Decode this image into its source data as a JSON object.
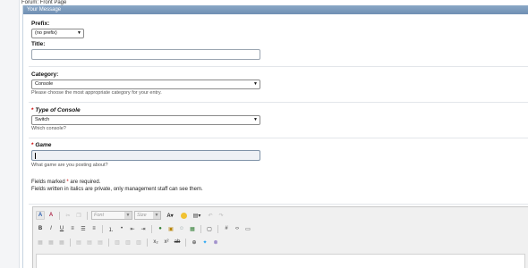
{
  "breadcrumb": "Forum: Front Page",
  "panel": {
    "title": "Your Message"
  },
  "prefix": {
    "label": "Prefix:",
    "value": "(no prefix)"
  },
  "title": {
    "label": "Title:",
    "value": ""
  },
  "category": {
    "label": "Category:",
    "value": "Console",
    "hint": "Please choose the most appropriate category for your entry."
  },
  "console_type": {
    "star": "*",
    "label": "Type of Console",
    "value": "Switch",
    "hint": "Which console?"
  },
  "game": {
    "star": "*",
    "label": "Game",
    "value": "",
    "hint": "What game are you posting about?"
  },
  "notes": {
    "line1_prefix": "Fields marked",
    "star": "*",
    "line1_suffix": "are required.",
    "line2": "Fields written in italics are private, only management staff can see them."
  },
  "editor": {
    "font_placeholder": "Font",
    "size_placeholder": "Size",
    "row1_icons": [
      "switch-mode-icon",
      "remove-format-icon",
      "cut-icon",
      "copy-icon",
      "font-select",
      "size-select",
      "text-color-icon",
      "highlight-icon",
      "paste-icon",
      "undo-icon",
      "redo-icon"
    ],
    "row2_icons": [
      "bold-icon",
      "italic-icon",
      "underline-icon",
      "align-left-icon",
      "align-center-icon",
      "align-right-icon",
      "ordered-list-icon",
      "unordered-list-icon",
      "outdent-icon",
      "indent-icon",
      "link-icon",
      "image-icon",
      "smilie-icon",
      "video-icon",
      "quote-icon",
      "hash-icon",
      "code-icon",
      "php-icon"
    ],
    "row3_icons": [
      "table-icon",
      "subscript-icon",
      "superscript-icon",
      "strikethrough-icon",
      "spoiler-icon",
      "twitter-icon",
      "attach-icon"
    ]
  }
}
